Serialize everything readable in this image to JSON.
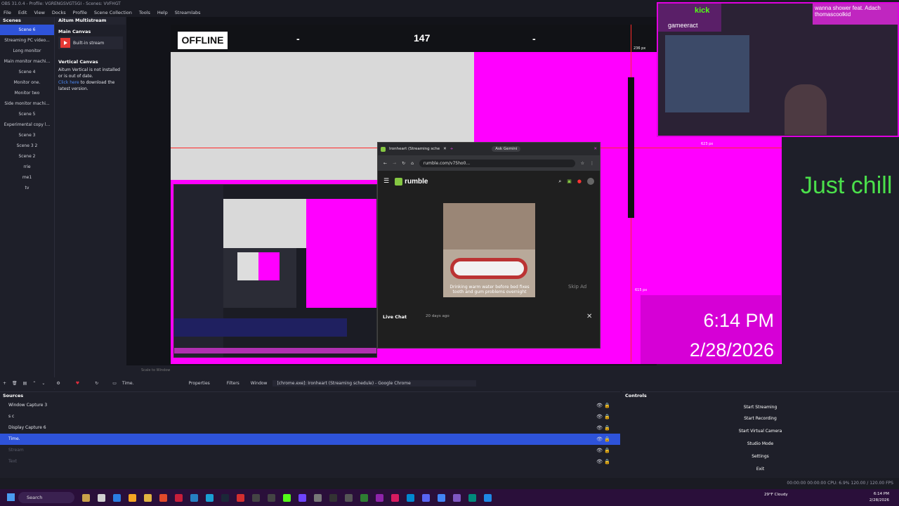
{
  "titlebar": "OBS 31.0.4 - Profile: VGRENGSVGT5GI - Scenes: VVFHGT",
  "menu": [
    "File",
    "Edit",
    "View",
    "Docks",
    "Profile",
    "Scene Collection",
    "Tools",
    "Help",
    "Streamlabs"
  ],
  "scenes": {
    "title": "Scenes",
    "items": [
      "Scene 6",
      "Streaming PC video...",
      "Long monitor",
      "Main monitor machi...",
      "Scene 4",
      "Monitor one.",
      "Monitor two",
      "Side monitor machi...",
      "Scene 5",
      "Experimental copy l...",
      "Scene 3",
      "Scene 3 2",
      "Scene 2",
      "rrie",
      "me1",
      "tv"
    ]
  },
  "aitum": {
    "title": "Aitum Multistream",
    "main_canvas": "Main Canvas",
    "built_in": "Built-in stream",
    "vertical_canvas": "Vertical Canvas",
    "vertical_msg": "Aitum Vertical is not installed or is out of date.",
    "link": "Click here",
    "link_suffix": " to download the latest version."
  },
  "preview": {
    "offline": "OFFLINE",
    "dash1": "-",
    "count": "147",
    "dash2": "-",
    "px_top": "236 px",
    "px_mid": "623 px",
    "px_low": "615 px",
    "just_chill": "Just chill",
    "time": "6:14 PM",
    "date": "2/28/2026",
    "chat_line1": "wanna shower feat. Adach",
    "chat_line2": "thomascoolkid",
    "cam_label1": "kick",
    "cam_label2": "gameeract"
  },
  "chrome": {
    "tab_title": "Ironheart (Streaming sche",
    "ask_gemini": "Ask Gemini",
    "url": "rumble.com/v75ho0...",
    "brand": "rumble",
    "caption": "Drinking warm water before bed fixes tooth and gum problems overnight",
    "skip_ad": "Skip Ad",
    "live_chat": "Live Chat",
    "ago": "20 days ago"
  },
  "toolbar": {
    "scale_label": "Scale to Window",
    "source_name": "Time.",
    "properties": "Properties",
    "filters": "Filters",
    "window_label": "Window",
    "window_value": "[chrome.exe]: Ironheart (Streaming schedule) - Google Chrome"
  },
  "sources": {
    "title": "Sources",
    "items": [
      {
        "name": "Window Capture 3",
        "state": "normal"
      },
      {
        "name": "s c",
        "state": "normal"
      },
      {
        "name": "Display Capture 6",
        "state": "normal"
      },
      {
        "name": "Time.",
        "state": "selected"
      },
      {
        "name": "Stream",
        "state": "dim"
      },
      {
        "name": "Text",
        "state": "dim"
      }
    ]
  },
  "controls": {
    "title": "Controls",
    "buttons": [
      "Start Streaming",
      "Start Recording",
      "Start Virtual Camera",
      "Studio Mode",
      "Settings",
      "Exit"
    ]
  },
  "status": "00:00:00   00:00:00   CPU: 6.9%   120.00 / 120.00 FPS",
  "taskbar": {
    "search": "Search",
    "weather": "29°F Cloudy",
    "clock_time": "6:14 PM",
    "clock_date": "2/28/2026"
  }
}
